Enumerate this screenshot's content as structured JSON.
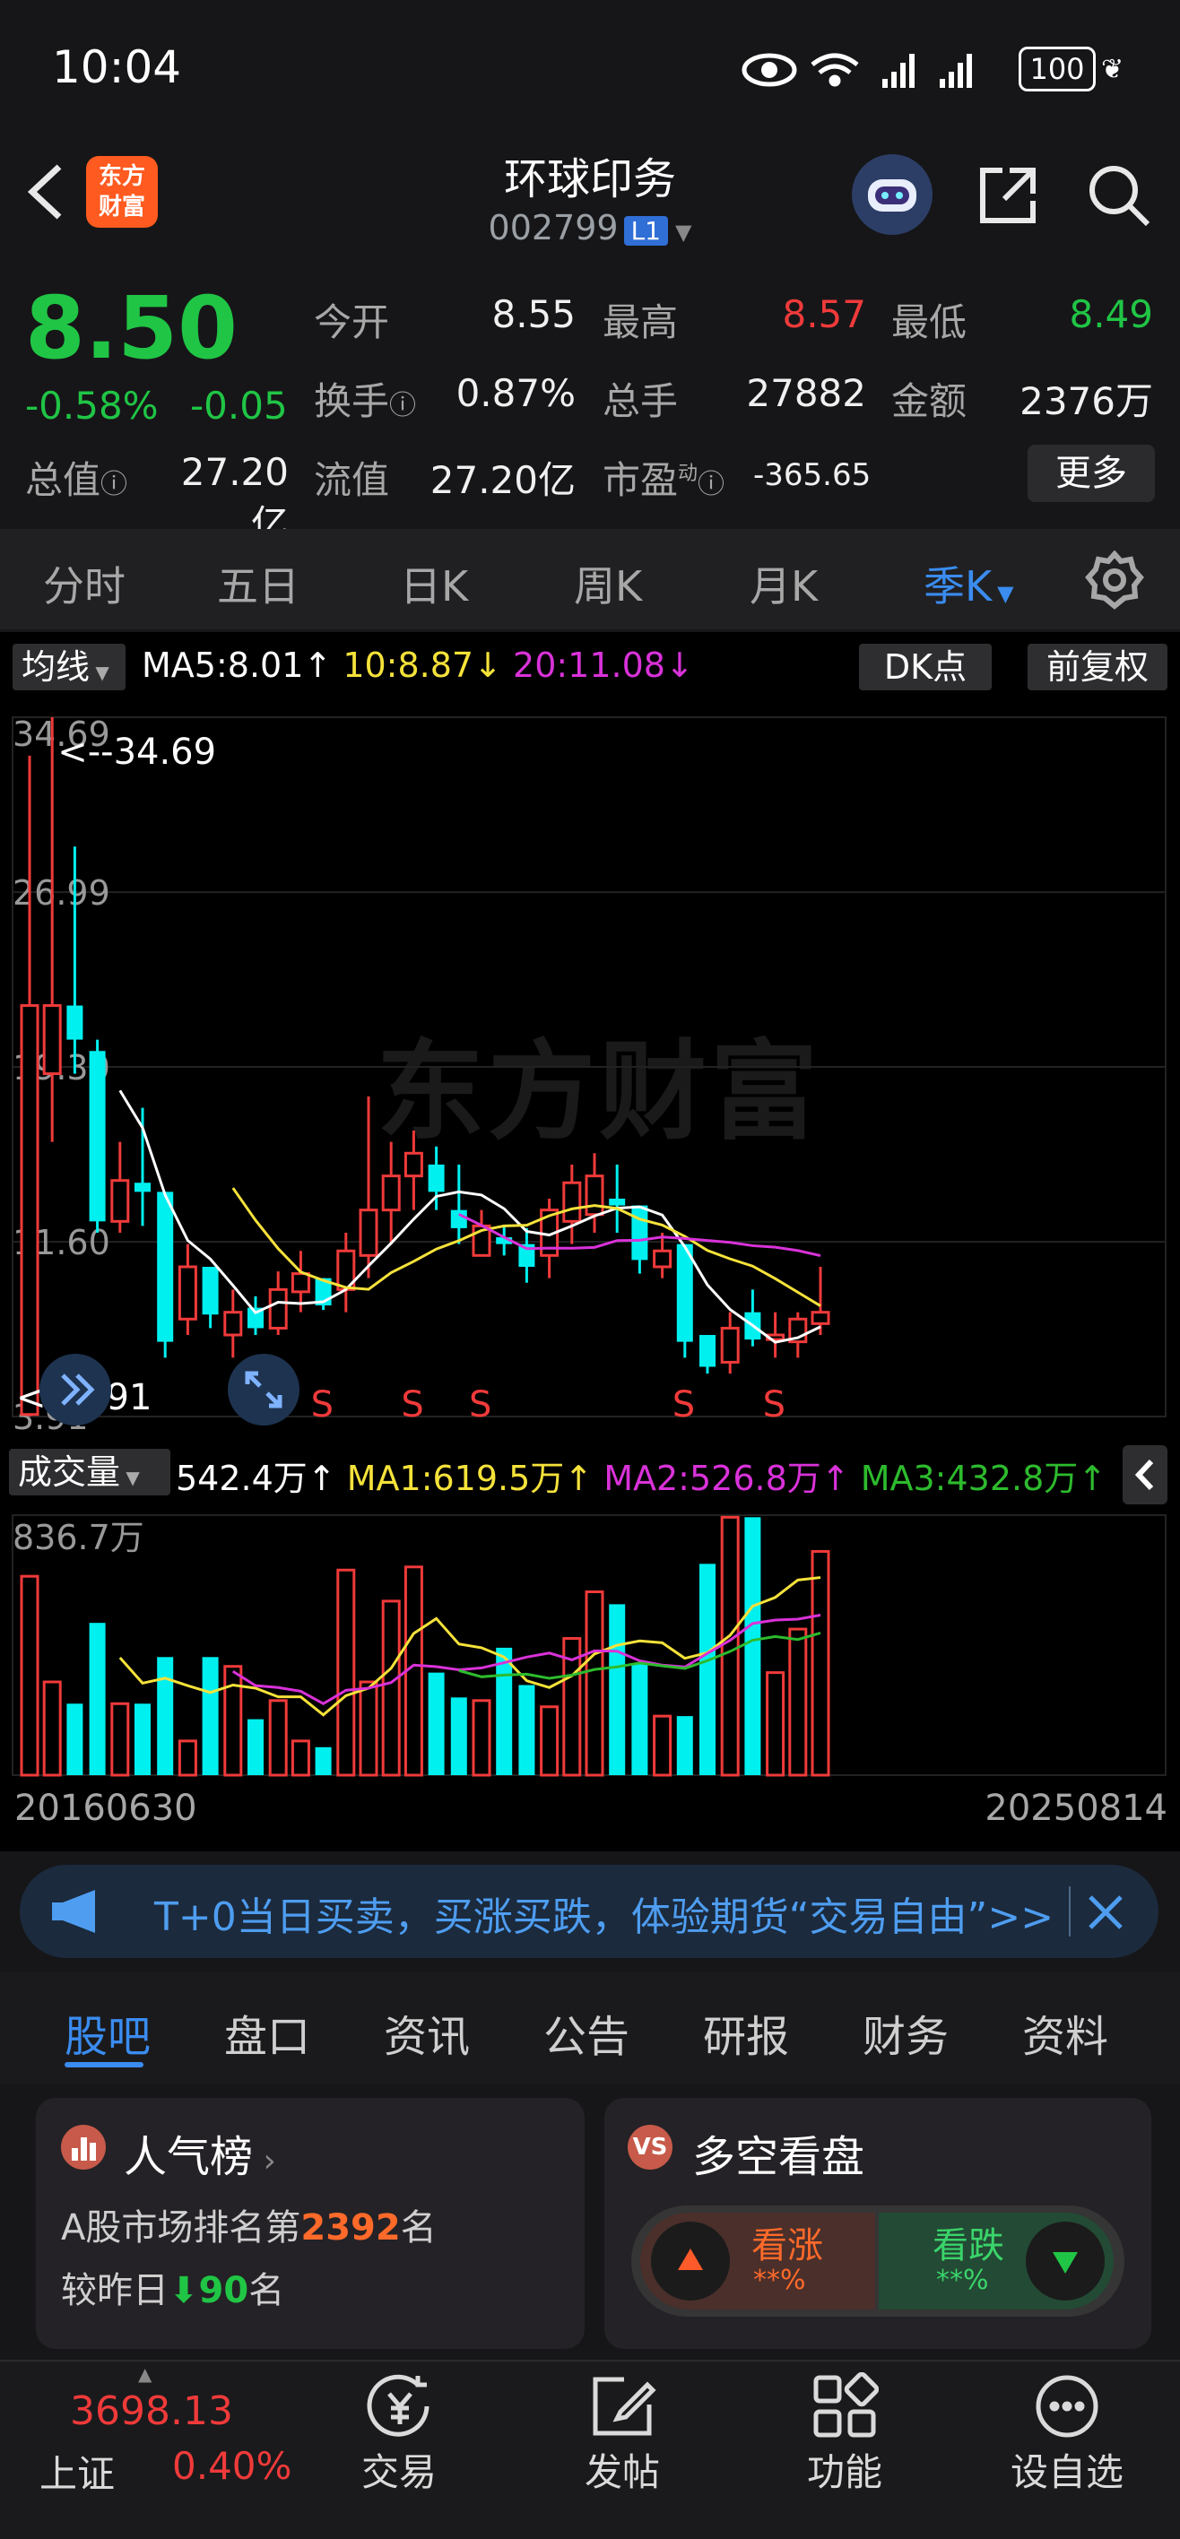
{
  "status_bar": {
    "time": "10:04",
    "battery": "100"
  },
  "header": {
    "app_logo": "东方\n财富",
    "stock_name": "环球印务",
    "stock_code": "002799",
    "level_badge": "L1"
  },
  "quote": {
    "price": "8.50",
    "change_pct": "-0.58%",
    "change": "-0.05",
    "open_label": "今开",
    "open": "8.55",
    "high_label": "最高",
    "high": "8.57",
    "low_label": "最低",
    "low": "8.49",
    "turnover_label": "换手",
    "turnover": "0.87%",
    "volume_label": "总手",
    "volume": "27882",
    "amount_label": "金额",
    "amount": "2376万",
    "total_cap_label": "总值",
    "total_cap": "27.20亿",
    "float_cap_label": "流值",
    "float_cap": "27.20亿",
    "pe_label": "市盈",
    "pe_sup": "动",
    "pe": "-365.65",
    "more_label": "更多"
  },
  "period_tabs": [
    "分时",
    "五日",
    "日K",
    "周K",
    "月K",
    "季K"
  ],
  "period_active": "季K",
  "indicator_bar": {
    "ma_label": "均线",
    "ma5": "MA5:8.01↑",
    "ma10": "10:8.87↓",
    "ma20": "20:11.08↓",
    "dk_label": "DK点",
    "adjust_label": "前复权"
  },
  "chart_data": {
    "type": "candlestick",
    "y_ticks": [
      "34.69",
      "26.99",
      "19.30",
      "11.60",
      "3.91"
    ],
    "ylim": [
      3.91,
      34.69
    ],
    "max_marker": "<--34.69",
    "min_marker": "<--3.91",
    "x_start": "20160630",
    "x_end": "20250814",
    "signal_letter": "S",
    "candles": [
      {
        "o": 4,
        "h": 33,
        "l": 3.91,
        "c": 22,
        "up": true
      },
      {
        "o": 19,
        "h": 34.69,
        "l": 16,
        "c": 22,
        "up": true
      },
      {
        "o": 22,
        "h": 29,
        "l": 19,
        "c": 20.5,
        "up": false
      },
      {
        "o": 20,
        "h": 20.5,
        "l": 12,
        "c": 12.5,
        "up": false
      },
      {
        "o": 12.5,
        "h": 16,
        "l": 12,
        "c": 14.3,
        "up": true
      },
      {
        "o": 14.2,
        "h": 17.5,
        "l": 12.3,
        "c": 13.8,
        "up": false
      },
      {
        "o": 13.8,
        "h": 13.8,
        "l": 6.5,
        "c": 7.2,
        "up": false
      },
      {
        "o": 8.2,
        "h": 11.5,
        "l": 7.5,
        "c": 10.5,
        "up": true
      },
      {
        "o": 10.5,
        "h": 10.5,
        "l": 7.8,
        "c": 8.4,
        "up": false
      },
      {
        "o": 7.5,
        "h": 9.5,
        "l": 6.5,
        "c": 8.5,
        "up": true
      },
      {
        "o": 8.7,
        "h": 9.2,
        "l": 7.5,
        "c": 7.8,
        "up": false
      },
      {
        "o": 7.8,
        "h": 10.3,
        "l": 7.5,
        "c": 9.5,
        "up": true
      },
      {
        "o": 9.4,
        "h": 11.2,
        "l": 8.5,
        "c": 10.2,
        "up": true
      },
      {
        "o": 10,
        "h": 10,
        "l": 8.6,
        "c": 8.8,
        "up": false
      },
      {
        "o": 9.5,
        "h": 12,
        "l": 8.5,
        "c": 11.2,
        "up": true
      },
      {
        "o": 11,
        "h": 18,
        "l": 10,
        "c": 13,
        "up": true
      },
      {
        "o": 13,
        "h": 16,
        "l": 11.5,
        "c": 14.5,
        "up": true
      },
      {
        "o": 14.5,
        "h": 16.5,
        "l": 13,
        "c": 15.5,
        "up": true
      },
      {
        "o": 15,
        "h": 15.8,
        "l": 13,
        "c": 13.8,
        "up": false
      },
      {
        "o": 13,
        "h": 15,
        "l": 11.5,
        "c": 12.2,
        "up": false
      },
      {
        "o": 11,
        "h": 13,
        "l": 11,
        "c": 12.3,
        "up": true
      },
      {
        "o": 11.8,
        "h": 12.3,
        "l": 11,
        "c": 11.5,
        "up": false
      },
      {
        "o": 11.5,
        "h": 12.2,
        "l": 9.8,
        "c": 10.5,
        "up": false
      },
      {
        "o": 11,
        "h": 13.5,
        "l": 10,
        "c": 13,
        "up": true
      },
      {
        "o": 12.5,
        "h": 15,
        "l": 11.5,
        "c": 14.2,
        "up": true
      },
      {
        "o": 12.8,
        "h": 15.5,
        "l": 12,
        "c": 14.5,
        "up": true
      },
      {
        "o": 13.5,
        "h": 15,
        "l": 12,
        "c": 13.2,
        "up": false
      },
      {
        "o": 13.2,
        "h": 13.2,
        "l": 10.2,
        "c": 10.8,
        "up": false
      },
      {
        "o": 10.5,
        "h": 12,
        "l": 10,
        "c": 11.2,
        "up": true
      },
      {
        "o": 11.5,
        "h": 11.5,
        "l": 6.5,
        "c": 7.2,
        "up": false
      },
      {
        "o": 7.5,
        "h": 7.5,
        "l": 5.8,
        "c": 6.1,
        "up": false
      },
      {
        "o": 6.3,
        "h": 8.5,
        "l": 5.8,
        "c": 7.8,
        "up": true
      },
      {
        "o": 8.5,
        "h": 9.5,
        "l": 7,
        "c": 7.3,
        "up": false
      },
      {
        "o": 7.3,
        "h": 8.5,
        "l": 6.5,
        "c": 7.5,
        "up": true
      },
      {
        "o": 7.2,
        "h": 8.5,
        "l": 6.5,
        "c": 8.2,
        "up": true
      },
      {
        "o": 8,
        "h": 10.5,
        "l": 7.5,
        "c": 8.5,
        "up": true
      }
    ],
    "signals_at": [
      13,
      17,
      20,
      29,
      33
    ],
    "volume": {
      "label": "成交量",
      "current": "542.4万↑",
      "ma1": "MA1:619.5万↑",
      "ma2": "MA2:526.8万↑",
      "ma3": "MA3:432.8万↑",
      "max_tick": "836.7万",
      "values_wan": [
        640,
        300,
        230,
        490,
        230,
        230,
        380,
        110,
        380,
        350,
        180,
        240,
        110,
        90,
        660,
        300,
        560,
        670,
        330,
        250,
        240,
        410,
        290,
        220,
        440,
        590,
        550,
        360,
        190,
        190,
        680,
        830,
        830,
        330,
        470,
        720
      ]
    }
  },
  "ad_banner": {
    "text": "T+0当日买卖，买涨买跌，体验期货“交易自由”>>"
  },
  "content_tabs": [
    "股吧",
    "盘口",
    "资讯",
    "公告",
    "研报",
    "财务",
    "资料"
  ],
  "content_active": "股吧",
  "popularity_card": {
    "title": "人气榜",
    "rank_prefix": "A股市场排名第",
    "rank": "2392",
    "rank_suffix": "名",
    "cmp_prefix": "较昨日",
    "cmp_value": "90",
    "cmp_suffix": "名"
  },
  "sentiment_card": {
    "title": "多空看盘",
    "bull_label": "看涨",
    "bull_value": "**%",
    "bear_label": "看跌",
    "bear_value": "**%"
  },
  "bottom_bar": {
    "index_value": "3698.13",
    "index_name": "上证",
    "index_change": "0.40%",
    "trade": "交易",
    "post": "发帖",
    "functions": "功能",
    "set_watch": "设自选"
  },
  "colors": {
    "up": "#f03a3a",
    "down": "#00f0f0",
    "green": "#20c545",
    "accent": "#3a8cf0",
    "ma5": "#ffffff",
    "ma10": "#f5e23a",
    "ma20": "#d932d9",
    "vma3": "#2dbb2d"
  }
}
